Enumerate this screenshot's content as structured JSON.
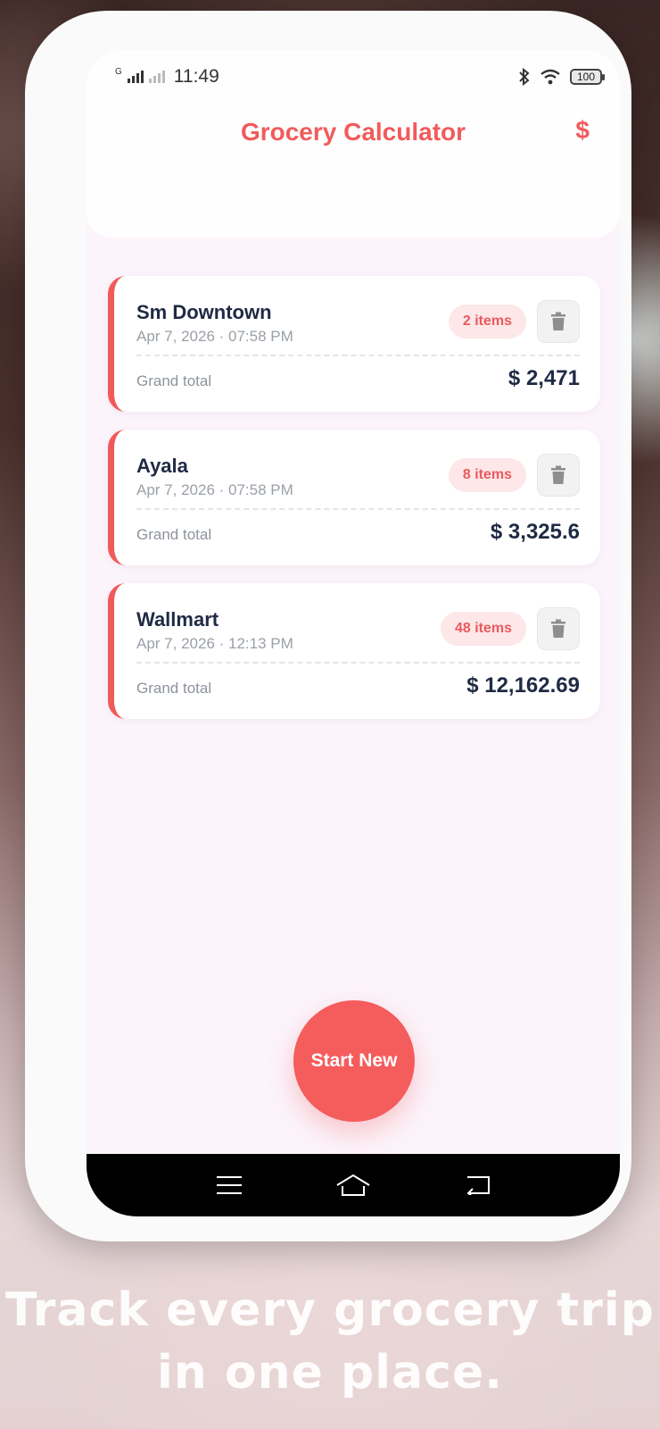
{
  "status": {
    "time": "11:49",
    "battery": "100",
    "network": "G"
  },
  "header": {
    "title": "Grocery Calculator",
    "currency_symbol": "$"
  },
  "trips": [
    {
      "name": "Sm Downtown",
      "date": "Apr 7, 2026 · 07:58 PM",
      "items": "2 items",
      "total_label": "Grand total",
      "total": "$ 2,471"
    },
    {
      "name": "Ayala",
      "date": "Apr 7, 2026 · 07:58 PM",
      "items": "8 items",
      "total_label": "Grand total",
      "total": "$ 3,325.6"
    },
    {
      "name": "Wallmart",
      "date": "Apr 7, 2026 · 12:13 PM",
      "items": "48 items",
      "total_label": "Grand total",
      "total": "$ 12,162.69"
    }
  ],
  "fab": {
    "label": "Start New"
  },
  "caption": {
    "line1": "Track every grocery trip",
    "line2": "in one place."
  },
  "colors": {
    "accent": "#f15b5b",
    "badge_bg": "#fde7e8",
    "text_dark": "#1f2a44"
  },
  "icons": {
    "trash": "trash-icon",
    "menu": "menu-icon",
    "home": "home-icon",
    "back": "back-icon"
  }
}
